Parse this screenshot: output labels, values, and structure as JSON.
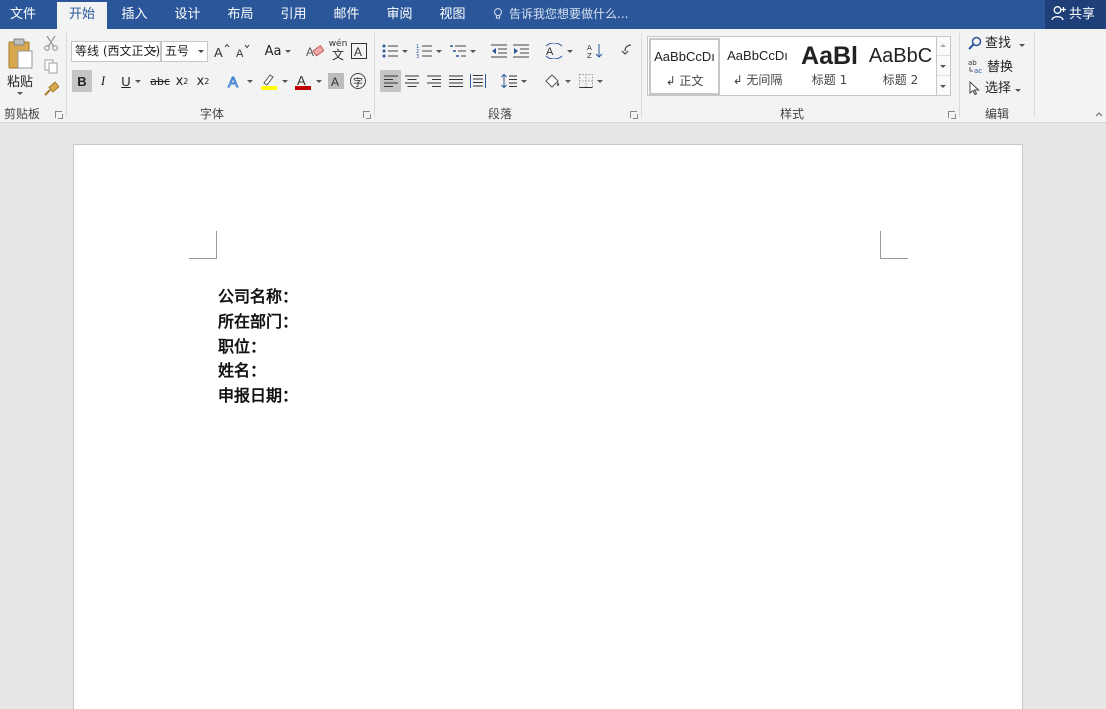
{
  "tabs": {
    "file": "文件",
    "home": "开始",
    "insert": "插入",
    "design": "设计",
    "layout": "布局",
    "references": "引用",
    "mailings": "邮件",
    "review": "审阅",
    "view": "视图"
  },
  "tell_me": "告诉我您想要做什么...",
  "share": "共享",
  "ribbon": {
    "clipboard": {
      "paste": "粘贴",
      "label": "剪贴板"
    },
    "font": {
      "font_name": "等线 (西文正文)",
      "font_size": "五号",
      "change_case": "Aa",
      "phonetic": "wén",
      "bold": "B",
      "italic": "I",
      "underline": "U",
      "strike": "abc",
      "subscript": "x",
      "superscript": "x",
      "enclose": "字",
      "label": "字体"
    },
    "paragraph": {
      "label": "段落"
    },
    "styles": {
      "items": [
        {
          "sample": "AaBbCcDı",
          "name": "↲ 正文"
        },
        {
          "sample": "AaBbCcDı",
          "name": "↲ 无间隔"
        },
        {
          "sample": "AaBl",
          "name": "标题 1"
        },
        {
          "sample": "AaBbC",
          "name": "标题 2"
        }
      ],
      "label": "样式"
    },
    "editing": {
      "find": "查找",
      "replace": "替换",
      "select": "选择",
      "label": "编辑"
    }
  },
  "document": {
    "lines": [
      "公司名称：",
      "所在部门：",
      "职位：",
      "姓名：",
      "申报日期："
    ]
  },
  "colors": {
    "title_bar": "#2b579a",
    "highlight": "#ffff00",
    "font_color": "#c00000"
  }
}
